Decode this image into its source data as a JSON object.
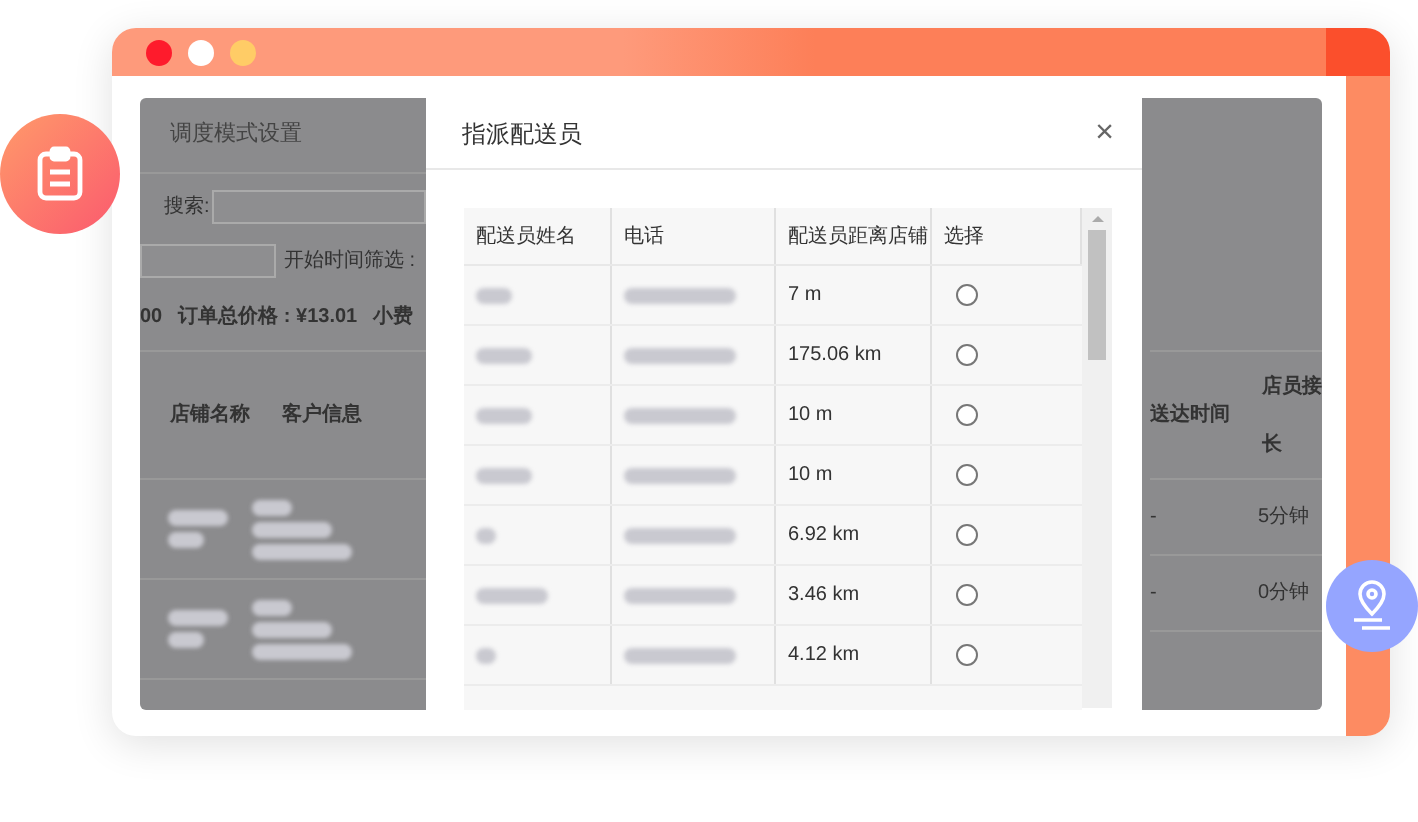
{
  "background_page": {
    "title": "调度模式设置",
    "search_label": "搜索:",
    "time_filter_label": "开始时间筛选 :",
    "summary": [
      "00",
      "订单总价格 : ¥13.01",
      "小费"
    ],
    "columns_left": [
      "店铺名称",
      "客户信息"
    ],
    "columns_right": [
      "送达时间",
      "店员接",
      "长"
    ],
    "rows": [
      {
        "delivery_time": "-",
        "duration": "5分钟"
      },
      {
        "delivery_time": "-",
        "duration": "0分钟"
      }
    ]
  },
  "modal": {
    "title": "指派配送员",
    "close": "×",
    "columns": [
      "配送员姓名",
      "电话",
      "配送员距离店铺",
      "选择"
    ],
    "rows": [
      {
        "distance": "7 m",
        "selected": false
      },
      {
        "distance": "175.06 km",
        "selected": false
      },
      {
        "distance": "10 m",
        "selected": false
      },
      {
        "distance": "10 m",
        "selected": false
      },
      {
        "distance": "6.92 km",
        "selected": false
      },
      {
        "distance": "3.46 km",
        "selected": false
      },
      {
        "distance": "4.12 km",
        "selected": false
      }
    ]
  }
}
